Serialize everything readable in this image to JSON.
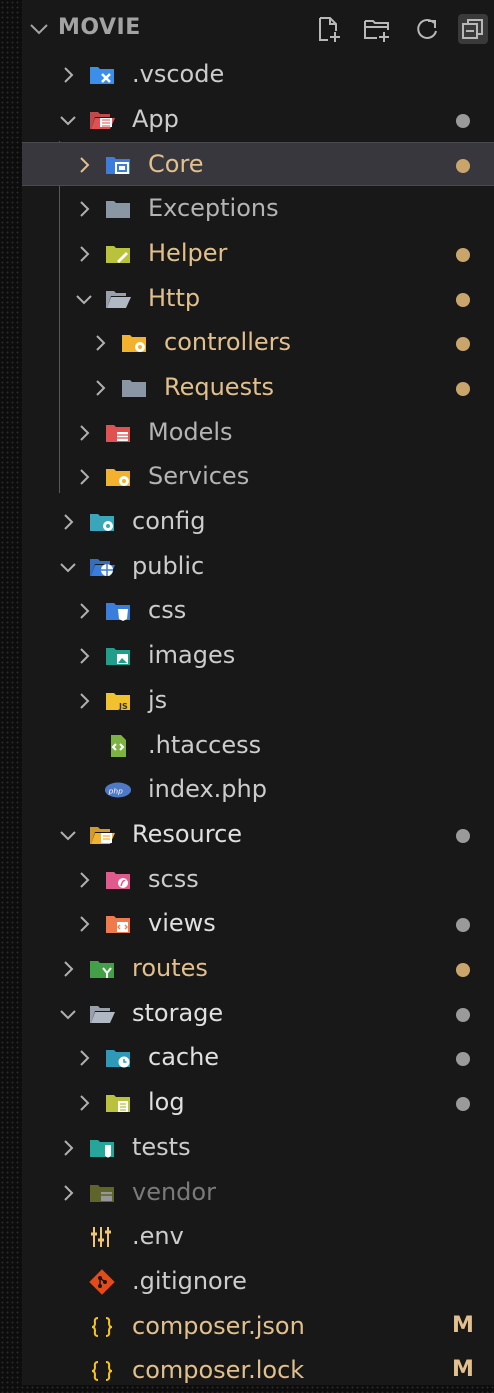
{
  "explorer": {
    "section_title": "MOVIE",
    "toolbar": [
      {
        "icon": "new-file-icon"
      },
      {
        "icon": "new-folder-icon"
      },
      {
        "icon": "refresh-icon"
      },
      {
        "icon": "collapse-all-icon"
      }
    ]
  },
  "colors": {
    "default_text": "#cccccc",
    "modified_text": "#e2c08d",
    "ignored_text": "#7a7a7a",
    "git_badge": "#e2c08d",
    "dot_modified": "#c9a56b",
    "dot_grey": "#9a9a9a"
  },
  "tree": [
    {
      "label": ".vscode",
      "depth": 0,
      "type": "folder",
      "expanded": false,
      "icon": "vscode-folder-icon",
      "status": "normal"
    },
    {
      "label": "App",
      "depth": 0,
      "type": "folder",
      "expanded": true,
      "icon": "app-folder-icon",
      "status": "normal",
      "dot": "grey"
    },
    {
      "label": "Core",
      "depth": 1,
      "type": "folder",
      "expanded": false,
      "icon": "core-folder-icon",
      "status": "modified",
      "dot": "modified",
      "selected": true
    },
    {
      "label": "Exceptions",
      "depth": 1,
      "type": "folder",
      "expanded": false,
      "icon": "plain-folder-icon",
      "status": "dim"
    },
    {
      "label": "Helper",
      "depth": 1,
      "type": "folder",
      "expanded": false,
      "icon": "helper-folder-icon",
      "status": "modified",
      "dot": "modified"
    },
    {
      "label": "Http",
      "depth": 1,
      "type": "folder",
      "expanded": true,
      "icon": "open-folder-icon",
      "status": "modified",
      "dot": "modified"
    },
    {
      "label": "controllers",
      "depth": 2,
      "type": "folder",
      "expanded": false,
      "icon": "controllers-folder-icon",
      "status": "modified",
      "dot": "modified"
    },
    {
      "label": "Requests",
      "depth": 2,
      "type": "folder",
      "expanded": false,
      "icon": "plain-folder-icon",
      "status": "modified",
      "dot": "modified"
    },
    {
      "label": "Models",
      "depth": 1,
      "type": "folder",
      "expanded": false,
      "icon": "models-folder-icon",
      "status": "dim"
    },
    {
      "label": "Services",
      "depth": 1,
      "type": "folder",
      "expanded": false,
      "icon": "services-folder-icon",
      "status": "dim"
    },
    {
      "label": "config",
      "depth": 0,
      "type": "folder",
      "expanded": false,
      "icon": "config-folder-icon",
      "status": "normal"
    },
    {
      "label": "public",
      "depth": 0,
      "type": "folder",
      "expanded": true,
      "icon": "public-folder-icon",
      "status": "normal"
    },
    {
      "label": "css",
      "depth": 1,
      "type": "folder",
      "expanded": false,
      "icon": "css-folder-icon",
      "status": "normal"
    },
    {
      "label": "images",
      "depth": 1,
      "type": "folder",
      "expanded": false,
      "icon": "images-folder-icon",
      "status": "normal"
    },
    {
      "label": "js",
      "depth": 1,
      "type": "folder",
      "expanded": false,
      "icon": "js-folder-icon",
      "status": "normal"
    },
    {
      "label": ".htaccess",
      "depth": 1,
      "type": "file",
      "icon": "htaccess-file-icon",
      "status": "normal"
    },
    {
      "label": "index.php",
      "depth": 1,
      "type": "file",
      "icon": "php-file-icon",
      "status": "normal"
    },
    {
      "label": "Resource",
      "depth": 0,
      "type": "folder",
      "expanded": true,
      "icon": "resource-folder-icon",
      "status": "bright",
      "dot": "grey"
    },
    {
      "label": "scss",
      "depth": 1,
      "type": "folder",
      "expanded": false,
      "icon": "scss-folder-icon",
      "status": "normal"
    },
    {
      "label": "views",
      "depth": 1,
      "type": "folder",
      "expanded": false,
      "icon": "views-folder-icon",
      "status": "bright",
      "dot": "grey"
    },
    {
      "label": "routes",
      "depth": 0,
      "type": "folder",
      "expanded": false,
      "icon": "routes-folder-icon",
      "status": "modified",
      "dot": "modified"
    },
    {
      "label": "storage",
      "depth": 0,
      "type": "folder",
      "expanded": true,
      "icon": "open-folder-icon",
      "status": "bright",
      "dot": "grey"
    },
    {
      "label": "cache",
      "depth": 1,
      "type": "folder",
      "expanded": false,
      "icon": "cache-folder-icon",
      "status": "bright",
      "dot": "grey"
    },
    {
      "label": "log",
      "depth": 1,
      "type": "folder",
      "expanded": false,
      "icon": "log-folder-icon",
      "status": "bright",
      "dot": "grey"
    },
    {
      "label": "tests",
      "depth": 0,
      "type": "folder",
      "expanded": false,
      "icon": "tests-folder-icon",
      "status": "normal"
    },
    {
      "label": "vendor",
      "depth": 0,
      "type": "folder",
      "expanded": false,
      "icon": "vendor-folder-icon",
      "status": "ignored"
    },
    {
      "label": ".env",
      "depth": 0,
      "type": "file",
      "icon": "env-file-icon",
      "status": "normal"
    },
    {
      "label": ".gitignore",
      "depth": 0,
      "type": "file",
      "icon": "git-file-icon",
      "status": "normal"
    },
    {
      "label": "composer.json",
      "depth": 0,
      "type": "file",
      "icon": "json-file-icon",
      "status": "modified",
      "badge": "M"
    },
    {
      "label": "composer.lock",
      "depth": 0,
      "type": "file",
      "icon": "json-file-icon",
      "status": "modified",
      "badge": "M"
    }
  ]
}
